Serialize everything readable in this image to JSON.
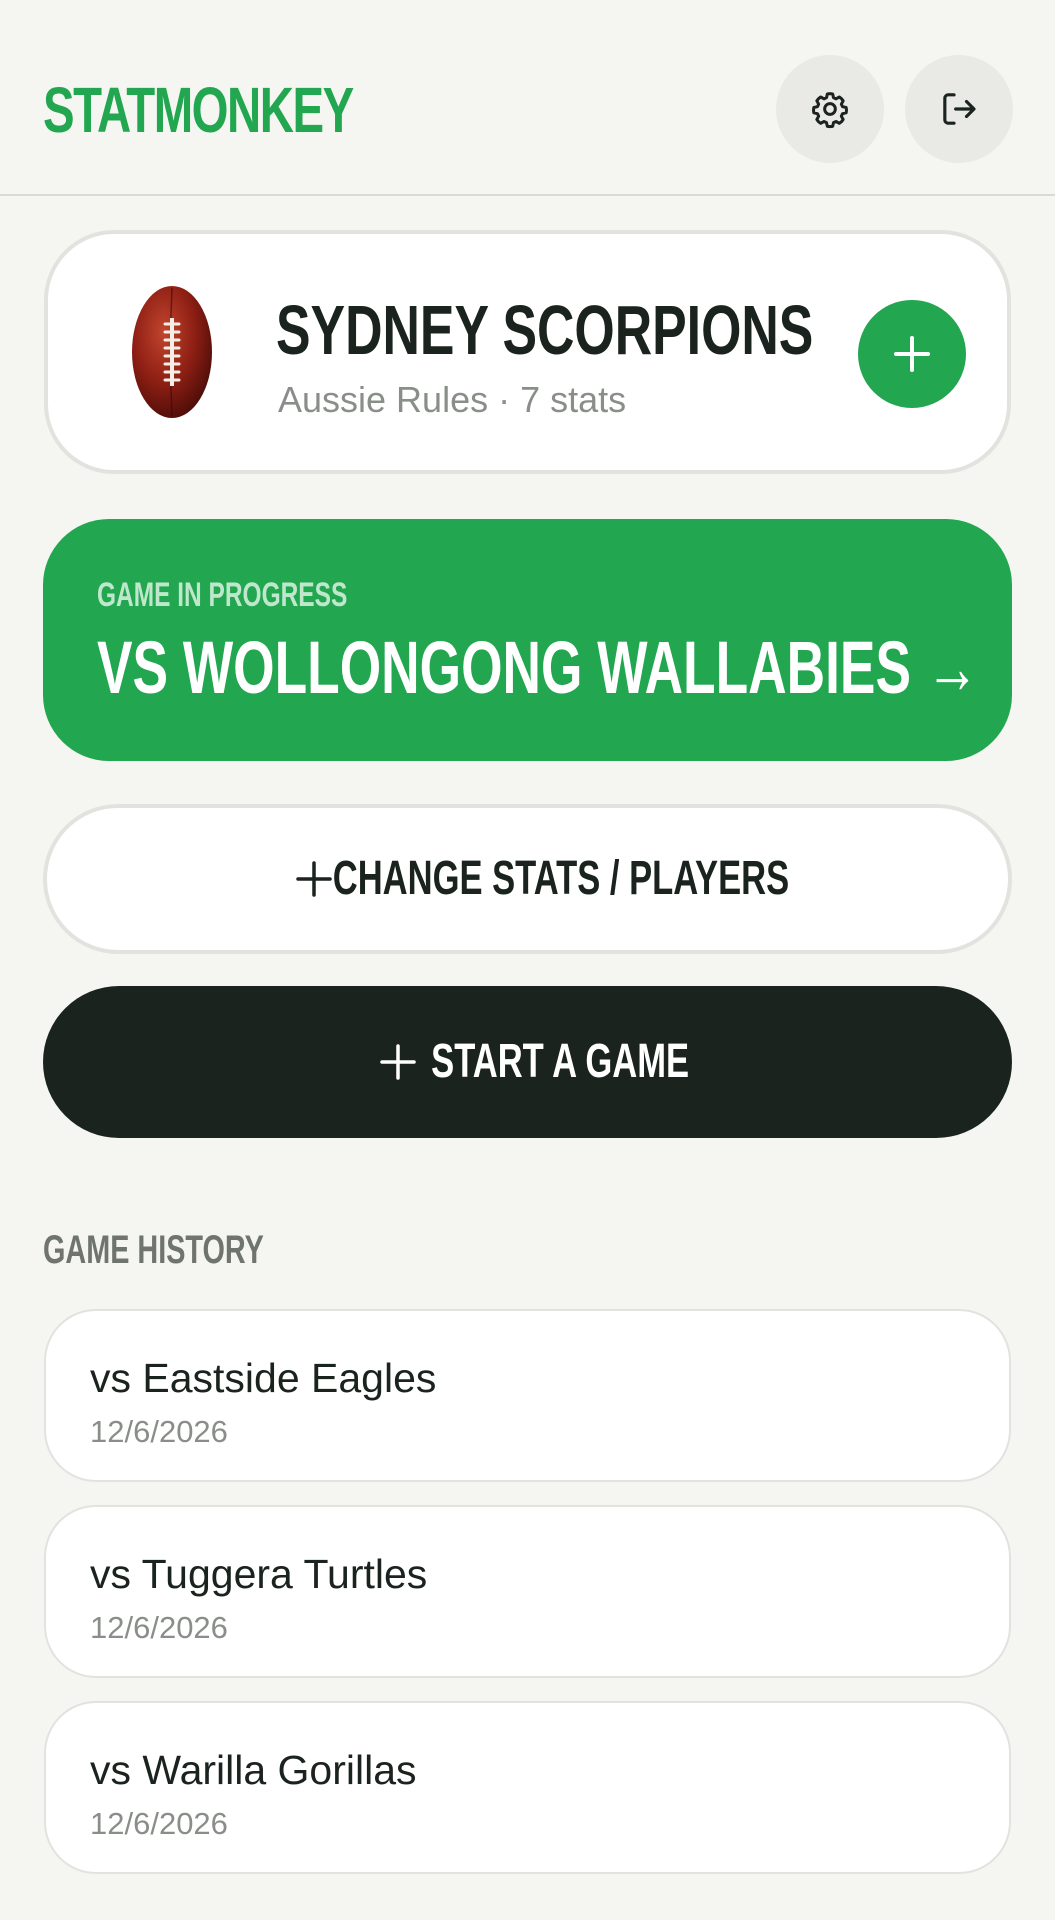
{
  "app": {
    "brand": "STATMONKEY",
    "accent_color": "#22a650",
    "dark_color": "#1a231d"
  },
  "header": {
    "settings_icon": "gear-icon",
    "logout_icon": "logout-icon"
  },
  "team": {
    "name": "SYDNEY SCORPIONS",
    "subtitle": "Aussie Rules · 7 stats",
    "logo_icon": "football-icon",
    "add_icon": "plus-icon"
  },
  "game_in_progress": {
    "kicker": "GAME IN PROGRESS",
    "title": "VS WOLLONGONG WALLABIES →"
  },
  "actions": {
    "change_label": "CHANGE STATS / PLAYERS",
    "start_label": "START A GAME"
  },
  "history": {
    "title": "GAME HISTORY",
    "games": [
      {
        "opponent": "vs Eastside Eagles",
        "date": "12/6/2026"
      },
      {
        "opponent": "vs Tuggera Turtles",
        "date": "12/6/2026"
      },
      {
        "opponent": "vs Warilla Gorillas",
        "date": "12/6/2026"
      }
    ]
  }
}
